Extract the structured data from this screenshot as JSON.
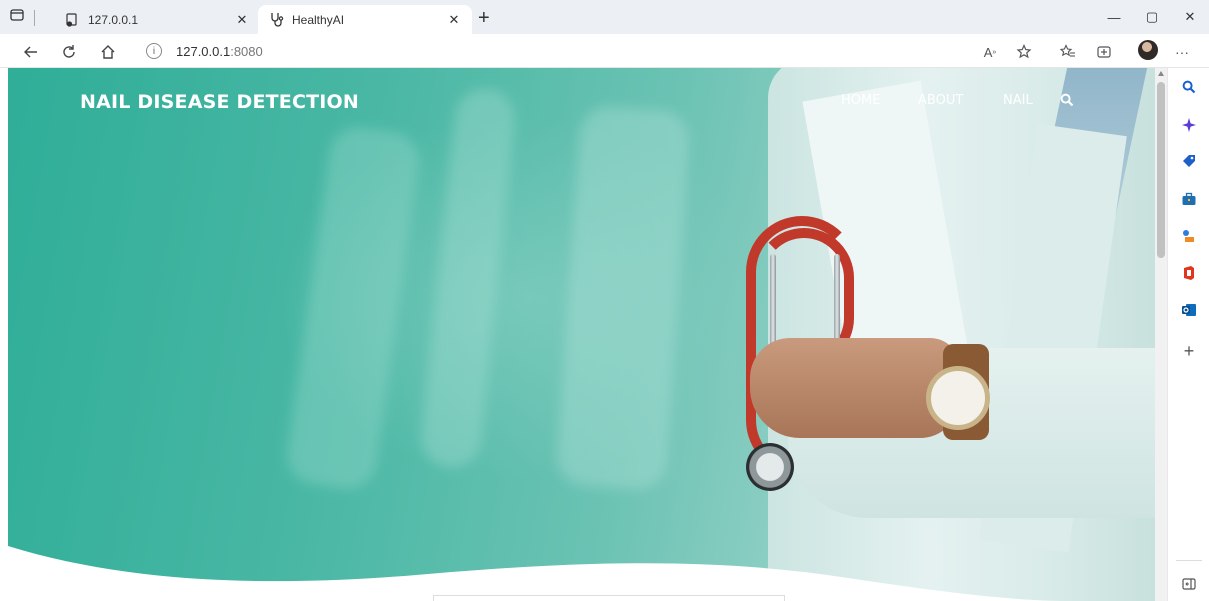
{
  "browser": {
    "tabs": [
      {
        "title": "127.0.0.1",
        "icon": "page-icon",
        "active": false
      },
      {
        "title": "HealthyAI",
        "icon": "stethoscope-icon",
        "active": true
      }
    ],
    "new_tab": "+",
    "address": {
      "host": "127.0.0.1",
      "port": ":8080"
    },
    "window_controls": {
      "minimize": "—",
      "restore": "▢",
      "close": "✕"
    }
  },
  "site": {
    "brand": "NAIL DISEASE DETECTION",
    "nav": [
      {
        "label": "HOME"
      },
      {
        "label": "ABOUT"
      },
      {
        "label": "NAIL"
      }
    ],
    "hero_color": "#3fb39f"
  },
  "sidebar": {
    "icons": [
      "search-icon",
      "copilot-icon",
      "tag-icon",
      "toolbox-icon",
      "games-icon",
      "office-icon",
      "outlook-icon",
      "add-icon",
      "sidebar-toggle-icon"
    ]
  }
}
